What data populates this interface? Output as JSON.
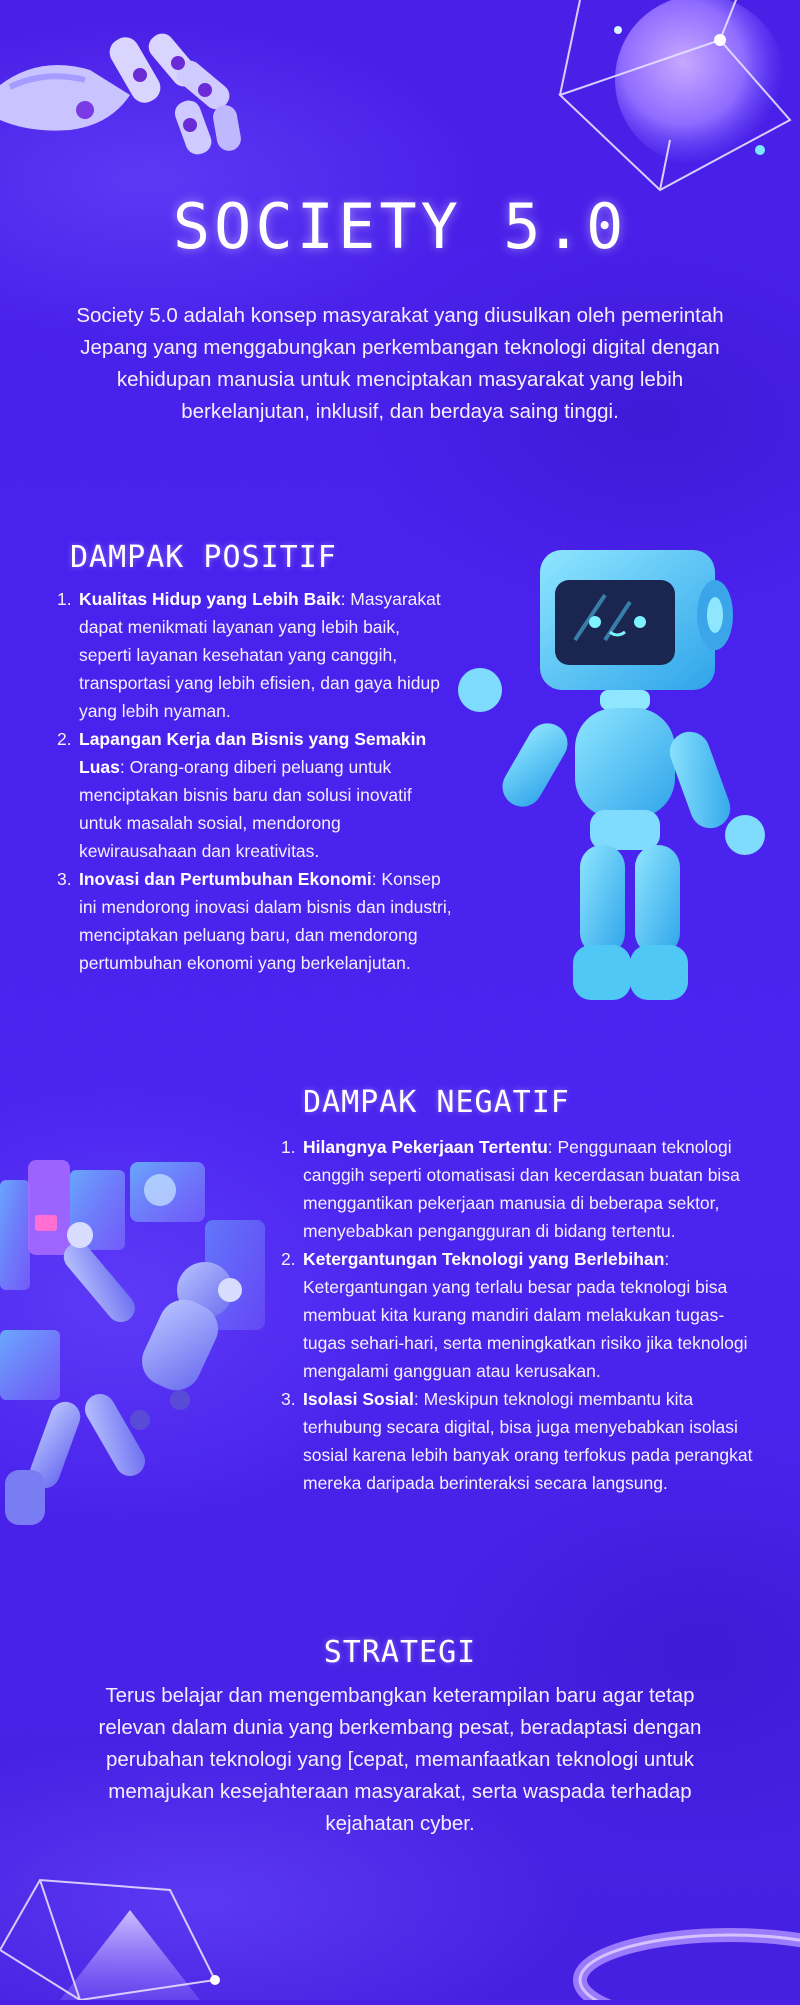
{
  "title": "SOCIETY 5.0",
  "intro": "Society 5.0 adalah konsep masyarakat yang diusulkan oleh pemerintah Jepang yang menggabungkan perkembangan teknologi digital dengan kehidupan manusia untuk menciptakan masyarakat yang lebih berkelanjutan, inklusif, dan berdaya saing tinggi.",
  "positive": {
    "heading": "DAMPAK POSITIF",
    "items": [
      {
        "num": "1.",
        "title": "Kualitas Hidup yang Lebih Baik",
        "text": ": Masyarakat dapat menikmati layanan yang lebih baik, seperti layanan kesehatan yang canggih, transportasi yang lebih efisien, dan gaya hidup yang lebih nyaman."
      },
      {
        "num": "2.",
        "title": "Lapangan Kerja dan Bisnis yang Semakin Luas",
        "text": ": Orang-orang diberi peluang untuk menciptakan bisnis baru dan solusi inovatif untuk masalah sosial, mendorong kewirausahaan dan kreativitas."
      },
      {
        "num": "3.",
        "title": "Inovasi dan Pertumbuhan Ekonomi",
        "text": ": Konsep ini mendorong inovasi dalam bisnis dan industri, menciptakan peluang baru, dan mendorong pertumbuhan ekonomi yang berkelanjutan."
      }
    ]
  },
  "negative": {
    "heading": "DAMPAK NEGATIF",
    "items": [
      {
        "num": "1.",
        "title": "Hilangnya Pekerjaan Tertentu",
        "text": ": Penggunaan teknologi canggih seperti otomatisasi dan kecerdasan buatan bisa menggantikan pekerjaan manusia di beberapa sektor, menyebabkan pengangguran di bidang tertentu."
      },
      {
        "num": "2.",
        "title": "Ketergantungan Teknologi yang Berlebihan",
        "text": ": Ketergantungan yang terlalu besar pada teknologi bisa membuat kita kurang mandiri dalam melakukan tugas-tugas sehari-hari, serta meningkatkan risiko jika teknologi mengalami gangguan atau kerusakan."
      },
      {
        "num": "3.",
        "title": "Isolasi Sosial",
        "text": ": Meskipun teknologi membantu kita terhubung secara digital, bisa juga menyebabkan isolasi sosial karena lebih banyak orang terfokus pada perangkat mereka daripada berinteraksi secara langsung."
      }
    ]
  },
  "strategy": {
    "heading": "STRATEGI",
    "text": "Terus belajar dan mengembangkan keterampilan baru agar tetap relevan dalam dunia yang berkembang pesat, beradaptasi dengan perubahan teknologi yang [cepat, memanfaatkan teknologi untuk memajukan kesejahteraan masyarakat, serta waspada terhadap kejahatan cyber."
  },
  "colors": {
    "background": "#4a22ee",
    "robot_cyan": "#4fc8f5",
    "robot_purple": "#8f8cff",
    "text": "#ffffff"
  },
  "icons": [
    "robot-hand-icon",
    "wireframe-cube-icon",
    "robot-tv-head-icon",
    "robot-holo-screens-icon",
    "wireframe-pyramid-icon",
    "ring-icon"
  ]
}
